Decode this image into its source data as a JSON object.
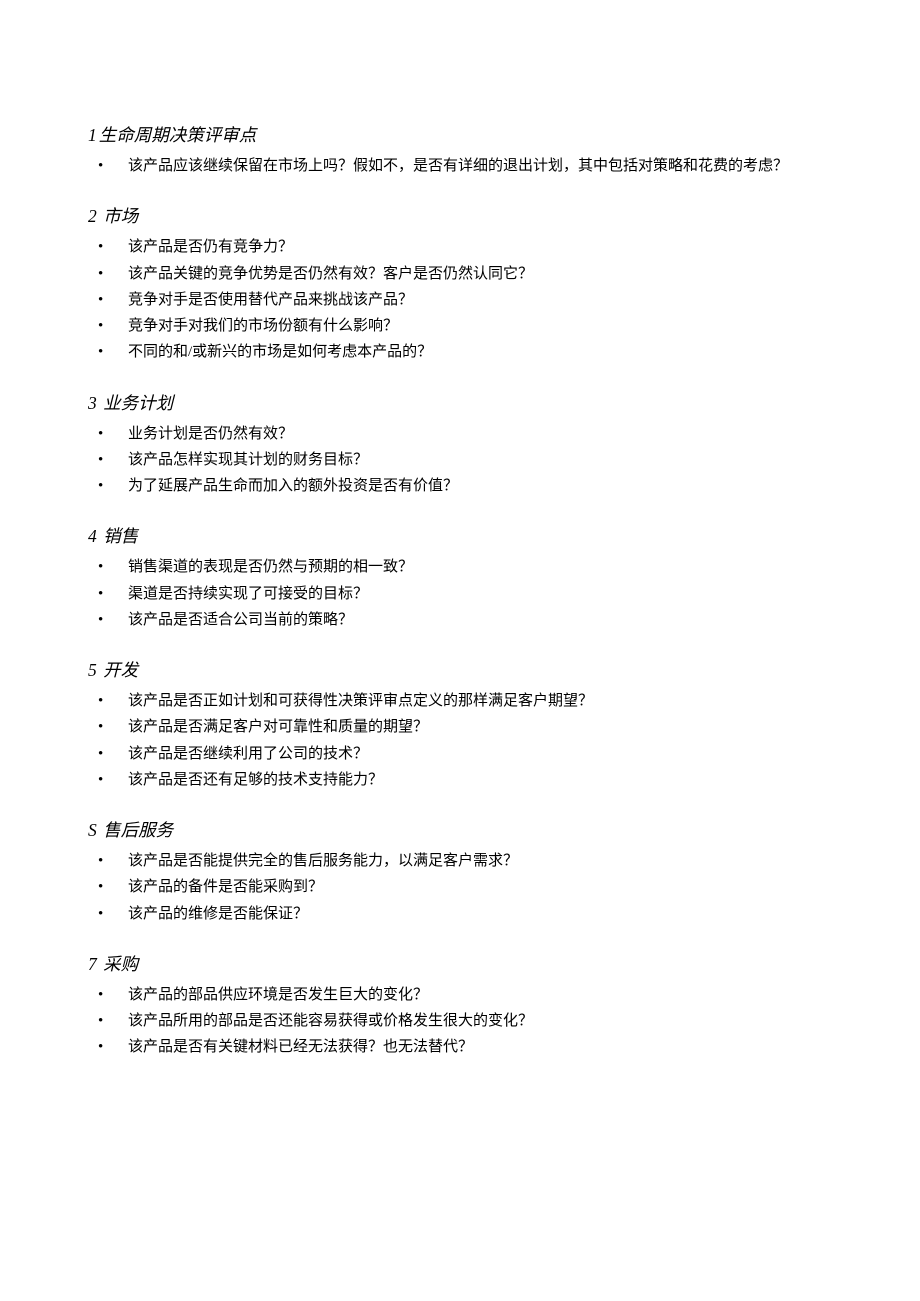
{
  "sections": [
    {
      "num": "1",
      "title": "生命周期决策评审点",
      "items": [
        "该产品应该继续保留在市场上吗？假如不，是否有详细的退出计划，其中包括对策略和花费的考虑？"
      ]
    },
    {
      "num": "2",
      "title": " 市场",
      "items": [
        "该产品是否仍有竞争力？",
        "该产品关键的竞争优势是否仍然有效？客户是否仍然认同它？",
        "竞争对手是否使用替代产品来挑战该产品？",
        "竞争对手对我们的市场份额有什么影响？",
        "不同的和/或新兴的市场是如何考虑本产品的？"
      ]
    },
    {
      "num": "3",
      "title": " 业务计划",
      "items": [
        "业务计划是否仍然有效？",
        "该产品怎样实现其计划的财务目标？",
        "为了延展产品生命而加入的额外投资是否有价值？"
      ]
    },
    {
      "num": "4",
      "title": " 销售",
      "items": [
        "销售渠道的表现是否仍然与预期的相一致？",
        "渠道是否持续实现了可接受的目标？",
        "该产品是否适合公司当前的策略？"
      ]
    },
    {
      "num": "5",
      "title": " 开发",
      "items": [
        "该产品是否正如计划和可获得性决策评审点定义的那样满足客户期望？",
        "该产品是否满足客户对可靠性和质量的期望？",
        "该产品是否继续利用了公司的技术？",
        "该产品是否还有足够的技术支持能力？"
      ]
    },
    {
      "num": "S",
      "title": " 售后服务",
      "items": [
        "该产品是否能提供完全的售后服务能力，以满足客户需求？",
        "该产品的备件是否能采购到？",
        "该产品的维修是否能保证？"
      ]
    },
    {
      "num": "7",
      "title": " 采购",
      "items": [
        "该产品的部品供应环境是否发生巨大的变化？",
        "该产品所用的部品是否还能容易获得或价格发生很大的变化？",
        "该产品是否有关键材料已经无法获得？也无法替代？"
      ]
    }
  ]
}
